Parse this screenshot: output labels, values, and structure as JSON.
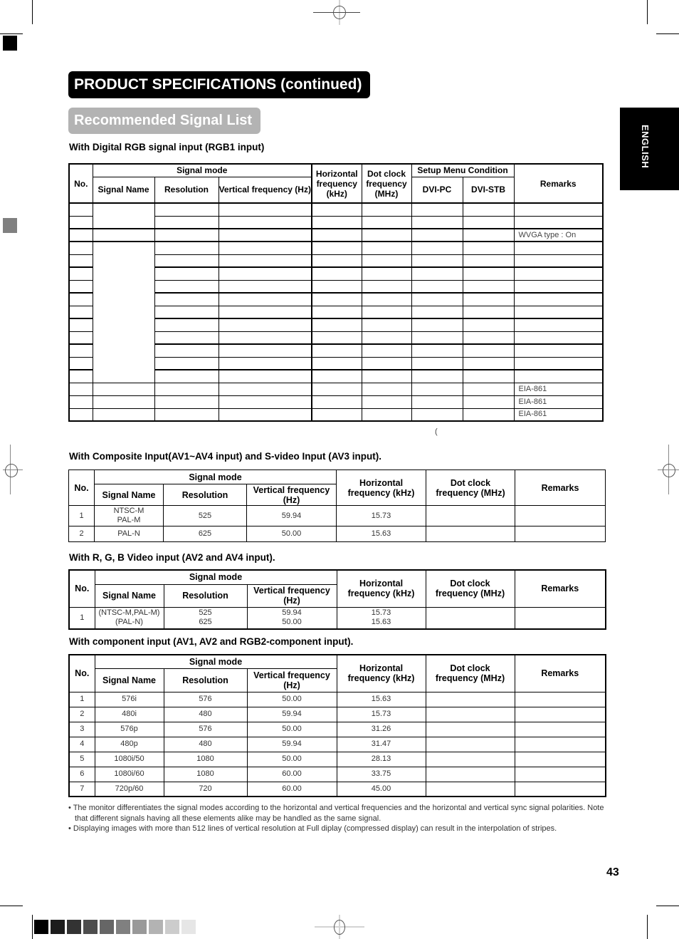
{
  "page": {
    "title": "PRODUCT SPECIFICATIONS (continued)",
    "subtitle": "Recommended Signal List",
    "language_tab": "ENGLISH",
    "page_number": "43",
    "stray_mark": "("
  },
  "colors": {
    "title_bg": "#000000",
    "subtitle_bg": "#b3b3b3",
    "gray_scale": [
      "#000000",
      "#1c1c1c",
      "#333333",
      "#4d4d4d",
      "#666666",
      "#808080",
      "#999999",
      "#b3b3b3",
      "#cccccc",
      "#e6e6e6"
    ]
  },
  "digital_rgb": {
    "heading": "With Digital RGB signal input (RGB1 input)",
    "headers": {
      "no": "No.",
      "signal_mode": "Signal mode",
      "signal_name": "Signal Name",
      "resolution": "Resolution",
      "vertical_frequency": "Vertical frequency (Hz)",
      "horizontal_frequency": "Horizontal frequency (kHz)",
      "dot_clock": "Dot clock frequency (MHz)",
      "setup_menu": "Setup Menu Condition",
      "dvi_pc": "DVI-PC",
      "dvi_stb": "DVI-STB",
      "remarks": "Remarks"
    },
    "rows": [
      {
        "remarks": ""
      },
      {
        "remarks": ""
      },
      {
        "remarks": "WVGA type : On"
      },
      {
        "remarks": ""
      },
      {
        "remarks": ""
      },
      {
        "remarks": ""
      },
      {
        "remarks": ""
      },
      {
        "remarks": ""
      },
      {
        "remarks": ""
      },
      {
        "remarks": ""
      },
      {
        "remarks": ""
      },
      {
        "remarks": ""
      },
      {
        "remarks": ""
      },
      {
        "remarks": ""
      },
      {
        "remarks": "EIA-861"
      },
      {
        "remarks": "EIA-861"
      },
      {
        "remarks": "EIA-861"
      }
    ]
  },
  "composite": {
    "heading": "With Composite Input(AV1~AV4 input) and S-video Input (AV3 input).",
    "headers": {
      "no": "No.",
      "signal_mode": "Signal mode",
      "signal_name": "Signal Name",
      "resolution": "Resolution",
      "vertical_frequency": "Vertical frequency (Hz)",
      "horizontal_frequency": "Horizontal frequency (kHz)",
      "dot_clock": "Dot clock frequency (MHz)",
      "remarks": "Remarks"
    },
    "rows": [
      {
        "no": "1",
        "signal_name_1": "NTSC-M",
        "signal_name_2": "PAL-M",
        "resolution": "525",
        "vertical": "59.94",
        "horizontal": "15.73",
        "dot_clock": "",
        "remarks": ""
      },
      {
        "no": "2",
        "signal_name_1": "PAL-N",
        "signal_name_2": "",
        "resolution": "625",
        "vertical": "50.00",
        "horizontal": "15.63",
        "dot_clock": "",
        "remarks": ""
      }
    ]
  },
  "rgb_video": {
    "heading": "With R, G, B Video input (AV2 and AV4 input).",
    "headers": {
      "no": "No.",
      "signal_mode": "Signal mode",
      "signal_name": "Signal Name",
      "resolution": "Resolution",
      "vertical_frequency": "Vertical frequency (Hz)",
      "horizontal_frequency": "Horizontal frequency (kHz)",
      "dot_clock": "Dot clock frequency (MHz)",
      "remarks": "Remarks"
    },
    "rows": [
      {
        "no": "1",
        "signal_name_1": "(NTSC-M,PAL-M)",
        "signal_name_2": "(PAL-N)",
        "resolution_1": "525",
        "resolution_2": "625",
        "vertical_1": "59.94",
        "vertical_2": "50.00",
        "horizontal_1": "15.73",
        "horizontal_2": "15.63",
        "dot_clock": "",
        "remarks": ""
      }
    ]
  },
  "component": {
    "heading": "With component input (AV1, AV2 and RGB2-component input).",
    "headers": {
      "no": "No.",
      "signal_mode": "Signal mode",
      "signal_name": "Signal Name",
      "resolution": "Resolution",
      "vertical_frequency": "Vertical frequency (Hz)",
      "horizontal_frequency": "Horizontal frequency (kHz)",
      "dot_clock": "Dot clock frequency (MHz)",
      "remarks": "Remarks"
    },
    "rows": [
      {
        "no": "1",
        "signal_name": "576i",
        "resolution": "576",
        "vertical": "50.00",
        "horizontal": "15.63",
        "dot_clock": "",
        "remarks": ""
      },
      {
        "no": "2",
        "signal_name": "480i",
        "resolution": "480",
        "vertical": "59.94",
        "horizontal": "15.73",
        "dot_clock": "",
        "remarks": ""
      },
      {
        "no": "3",
        "signal_name": "576p",
        "resolution": "576",
        "vertical": "50.00",
        "horizontal": "31.26",
        "dot_clock": "",
        "remarks": ""
      },
      {
        "no": "4",
        "signal_name": "480p",
        "resolution": "480",
        "vertical": "59.94",
        "horizontal": "31.47",
        "dot_clock": "",
        "remarks": ""
      },
      {
        "no": "5",
        "signal_name": "1080i/50",
        "resolution": "1080",
        "vertical": "50.00",
        "horizontal": "28.13",
        "dot_clock": "",
        "remarks": ""
      },
      {
        "no": "6",
        "signal_name": "1080i/60",
        "resolution": "1080",
        "vertical": "60.00",
        "horizontal": "33.75",
        "dot_clock": "",
        "remarks": ""
      },
      {
        "no": "7",
        "signal_name": "720p/60",
        "resolution": "720",
        "vertical": "60.00",
        "horizontal": "45.00",
        "dot_clock": "",
        "remarks": ""
      }
    ]
  },
  "notes": [
    "• The monitor differentiates the signal modes according to the horizontal and vertical frequencies and the horizontal and vertical sync signal polarities.  Note that different signals having all these elements alike may be handled as the same signal.",
    "• Displaying images with more than 512 lines of vertical resolution at Full diplay (compressed display) can result in the interpolation of stripes."
  ]
}
